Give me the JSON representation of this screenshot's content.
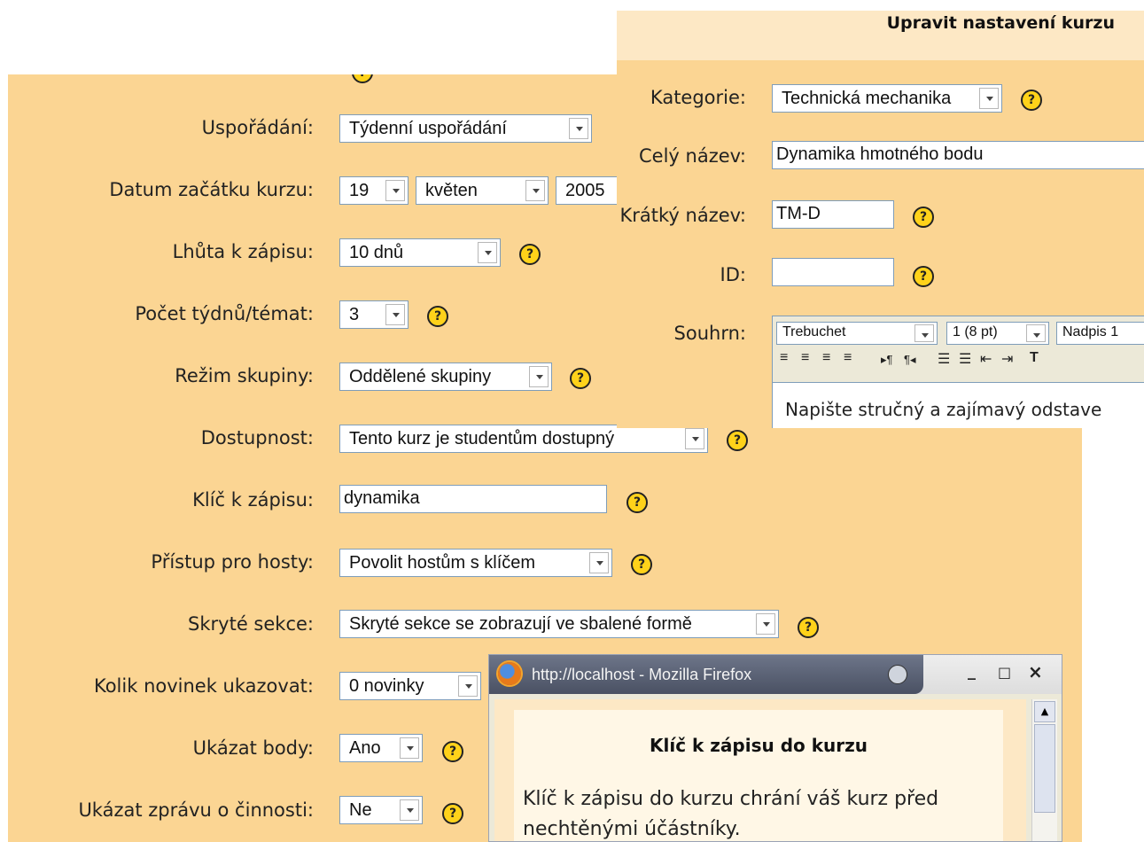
{
  "form": {
    "rows": [
      {
        "label": "Uspořádání:",
        "control": "select",
        "value": "Týdenní uspořádání"
      },
      {
        "label": "Datum začátku kurzu:",
        "control": "date",
        "day": "19",
        "month": "květen",
        "year": "2005"
      },
      {
        "label": "Lhůta k zápisu:",
        "control": "select",
        "value": "10 dnů"
      },
      {
        "label": "Počet týdnů/témat:",
        "control": "select",
        "value": "3"
      },
      {
        "label": "Režim skupiny:",
        "control": "select",
        "value": "Oddělené skupiny"
      },
      {
        "label": "Dostupnost:",
        "control": "select",
        "value": "Tento kurz je studentům dostupný"
      },
      {
        "label": "Klíč k zápisu:",
        "control": "input",
        "value": "dynamika"
      },
      {
        "label": "Přístup pro hosty:",
        "control": "select",
        "value": "Povolit hostům s klíčem"
      },
      {
        "label": "Skryté sekce:",
        "control": "select",
        "value": "Skryté sekce se zobrazují ve sbalené formě"
      },
      {
        "label": "Kolik novinek ukazovat:",
        "control": "select",
        "value": "0 novinky"
      },
      {
        "label": "Ukázat body:",
        "control": "select",
        "value": "Ano"
      },
      {
        "label": "Ukázat zprávu o činnosti:",
        "control": "select",
        "value": "Ne"
      }
    ]
  },
  "course_panel": {
    "title": "Upravit nastavení kurzu",
    "category_label": "Kategorie:",
    "category_value": "Technická mechanika",
    "fullname_label": "Celý název:",
    "fullname_value": "Dynamika hmotného bodu",
    "shortname_label": "Krátký název:",
    "shortname_value": "TM-D",
    "id_label": "ID:",
    "id_value": "",
    "summary_label": "Souhrn:",
    "editor": {
      "font": "Trebuchet",
      "size": "1 (8 pt)",
      "heading": "Nadpis 1",
      "content": "Napište stručný a zajímavý odstave"
    }
  },
  "popup": {
    "window_title": "http://localhost - Mozilla Firefox",
    "heading": "Klíč k zápisu do kurzu",
    "body_line1": "Klíč k zápisu do kurzu chrání váš kurz před",
    "body_line2": "nechtěnými účástníky.",
    "minimize": "_",
    "maximize": "□",
    "close": "×"
  },
  "help_glyph": "?",
  "colors": {
    "panel_bg": "#fbd593",
    "header_bg": "#fde8c5",
    "popup_titlebar": "#5a6272"
  }
}
